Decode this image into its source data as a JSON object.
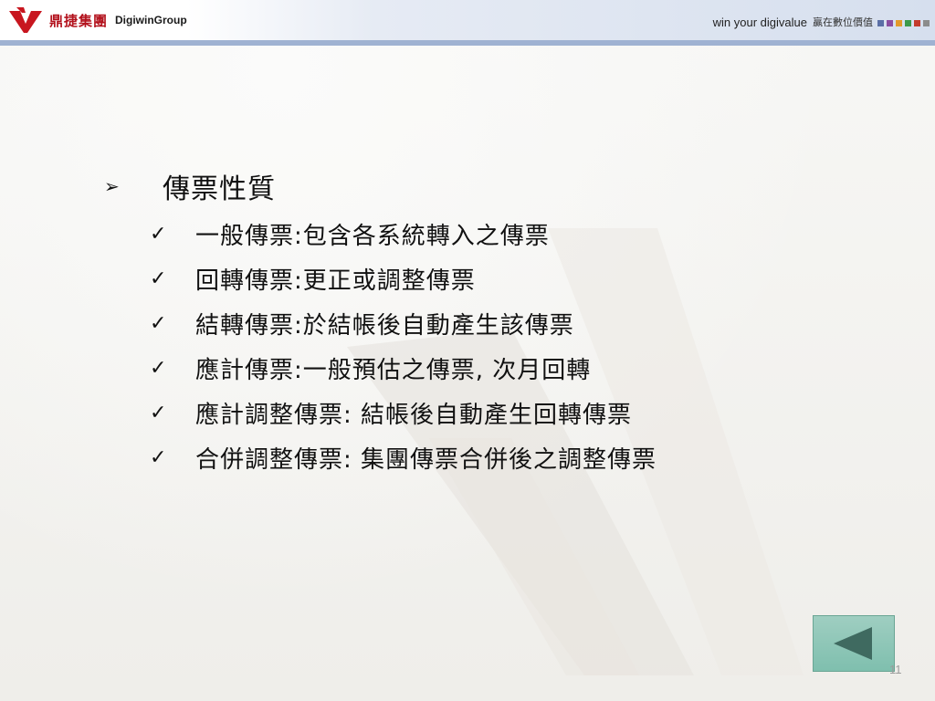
{
  "header": {
    "company_cn": "鼎捷集團",
    "company_en": "DigiwinGroup",
    "tagline": "win your digivalue",
    "tagline_cn": "贏在數位價值",
    "swatch_colors": [
      "#5b6fa6",
      "#8a4ea0",
      "#e39a2a",
      "#3c9a4a",
      "#c33b2c",
      "#8c8c8c"
    ]
  },
  "slide": {
    "heading": "傳票性質",
    "heading_bullet": "➢",
    "check_glyph": "✓",
    "items": [
      "一般傳票:包含各系統轉入之傳票",
      "回轉傳票:更正或調整傳票",
      "結轉傳票:於結帳後自動產生該傳票",
      "應計傳票:一般預估之傳票, 次月回轉",
      "應計調整傳票: 結帳後自動產生回轉傳票",
      "合併調整傳票: 集團傳票合併後之調整傳票"
    ]
  },
  "footer": {
    "page_number": "11"
  },
  "colors": {
    "logo_red": "#b3121d",
    "header_bar": "#9fb2d2",
    "nav_button": "#8cc7b6"
  }
}
